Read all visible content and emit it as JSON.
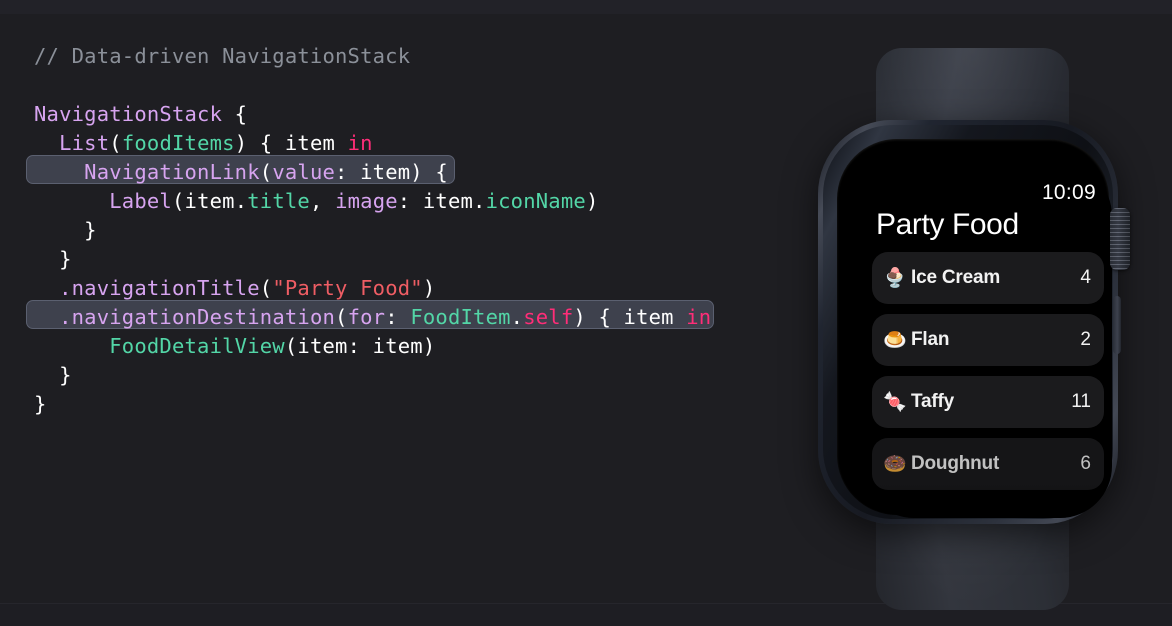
{
  "theme": {
    "background": "#1e1e22",
    "code_font_color": "#ffffff",
    "comment_color": "#8b9099",
    "type_color": "#d7a4f0",
    "identifier_color": "#53d6a7",
    "keyword_color": "#ff2d78",
    "string_color": "#ef5d64",
    "highlight_fill": "#3e414d",
    "highlight_border": "#5b6070"
  },
  "code": {
    "language": "Swift",
    "lines": [
      {
        "id": "comment",
        "highlighted": false,
        "tokens": [
          {
            "text": "// Data-driven NavigationStack",
            "kind": "comment"
          }
        ]
      },
      {
        "id": "blank-1",
        "highlighted": false,
        "tokens": []
      },
      {
        "id": "navigationstack-open",
        "highlighted": false,
        "tokens": [
          {
            "text": "NavigationStack",
            "kind": "type"
          },
          {
            "text": " {",
            "kind": "punct"
          }
        ]
      },
      {
        "id": "list-open",
        "highlighted": false,
        "tokens": [
          {
            "text": "  ",
            "kind": "plain"
          },
          {
            "text": "List",
            "kind": "type"
          },
          {
            "text": "(",
            "kind": "punct"
          },
          {
            "text": "foodItems",
            "kind": "ident"
          },
          {
            "text": ") { ",
            "kind": "punct"
          },
          {
            "text": "item",
            "kind": "plain"
          },
          {
            "text": " ",
            "kind": "plain"
          },
          {
            "text": "in",
            "kind": "key"
          }
        ]
      },
      {
        "id": "navigationlink",
        "highlighted": true,
        "tokens": [
          {
            "text": "    ",
            "kind": "plain"
          },
          {
            "text": "NavigationLink",
            "kind": "type"
          },
          {
            "text": "(",
            "kind": "punct"
          },
          {
            "text": "value",
            "kind": "type"
          },
          {
            "text": ": ",
            "kind": "punct"
          },
          {
            "text": "item",
            "kind": "plain"
          },
          {
            "text": ") {",
            "kind": "punct"
          }
        ]
      },
      {
        "id": "label",
        "highlighted": false,
        "tokens": [
          {
            "text": "      ",
            "kind": "plain"
          },
          {
            "text": "Label",
            "kind": "type"
          },
          {
            "text": "(",
            "kind": "punct"
          },
          {
            "text": "item",
            "kind": "plain"
          },
          {
            "text": ".",
            "kind": "punct"
          },
          {
            "text": "title",
            "kind": "ident"
          },
          {
            "text": ", ",
            "kind": "punct"
          },
          {
            "text": "image",
            "kind": "type"
          },
          {
            "text": ": ",
            "kind": "punct"
          },
          {
            "text": "item",
            "kind": "plain"
          },
          {
            "text": ".",
            "kind": "punct"
          },
          {
            "text": "iconName",
            "kind": "ident"
          },
          {
            "text": ")",
            "kind": "punct"
          }
        ]
      },
      {
        "id": "close-link",
        "highlighted": false,
        "tokens": [
          {
            "text": "    }",
            "kind": "punct"
          }
        ]
      },
      {
        "id": "close-list",
        "highlighted": false,
        "tokens": [
          {
            "text": "  }",
            "kind": "punct"
          }
        ]
      },
      {
        "id": "navigationtitle",
        "highlighted": false,
        "tokens": [
          {
            "text": "  ",
            "kind": "plain"
          },
          {
            "text": ".",
            "kind": "method"
          },
          {
            "text": "navigationTitle",
            "kind": "method"
          },
          {
            "text": "(",
            "kind": "punct"
          },
          {
            "text": "\"Party Food\"",
            "kind": "string"
          },
          {
            "text": ")",
            "kind": "punct"
          }
        ]
      },
      {
        "id": "navigationdestination",
        "highlighted": true,
        "tokens": [
          {
            "text": "  ",
            "kind": "plain"
          },
          {
            "text": ".",
            "kind": "method"
          },
          {
            "text": "navigationDestination",
            "kind": "method"
          },
          {
            "text": "(",
            "kind": "punct"
          },
          {
            "text": "for",
            "kind": "type"
          },
          {
            "text": ": ",
            "kind": "punct"
          },
          {
            "text": "FoodItem",
            "kind": "ident"
          },
          {
            "text": ".",
            "kind": "punct"
          },
          {
            "text": "self",
            "kind": "key"
          },
          {
            "text": ") { ",
            "kind": "punct"
          },
          {
            "text": "item",
            "kind": "plain"
          },
          {
            "text": " ",
            "kind": "plain"
          },
          {
            "text": "in",
            "kind": "key"
          }
        ]
      },
      {
        "id": "fooddetailview",
        "highlighted": false,
        "tokens": [
          {
            "text": "      ",
            "kind": "plain"
          },
          {
            "text": "FoodDetailView",
            "kind": "ident"
          },
          {
            "text": "(",
            "kind": "punct"
          },
          {
            "text": "item",
            "kind": "plain"
          },
          {
            "text": ": ",
            "kind": "punct"
          },
          {
            "text": "item",
            "kind": "plain"
          },
          {
            "text": ")",
            "kind": "punct"
          }
        ]
      },
      {
        "id": "close-destination",
        "highlighted": false,
        "tokens": [
          {
            "text": "  }",
            "kind": "punct"
          }
        ]
      },
      {
        "id": "close-stack",
        "highlighted": false,
        "tokens": [
          {
            "text": "}",
            "kind": "punct"
          }
        ]
      }
    ]
  },
  "watch": {
    "device": "Apple Watch",
    "status_time": "10:09",
    "nav_title": "Party Food",
    "list_items": [
      {
        "emoji": "🍨",
        "icon_name": "ice-cream-icon",
        "title": "Ice Cream",
        "count": "4",
        "dimmed": false
      },
      {
        "emoji": "🍮",
        "icon_name": "flan-icon",
        "title": "Flan",
        "count": "2",
        "dimmed": false
      },
      {
        "emoji": "🍬",
        "icon_name": "candy-icon",
        "title": "Taffy",
        "count": "11",
        "dimmed": false
      },
      {
        "emoji": "🍩",
        "icon_name": "doughnut-icon",
        "title": "Doughnut",
        "count": "6",
        "dimmed": true
      }
    ]
  }
}
